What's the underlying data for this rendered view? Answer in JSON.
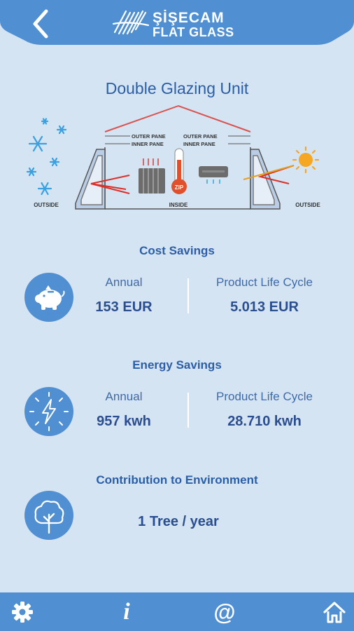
{
  "header": {
    "brand_line1": "ŞİŞECAM",
    "brand_line2": "FLAT GLASS"
  },
  "diagram": {
    "title": "Double Glazing Unit",
    "outer_pane_left": "OUTER PANE",
    "inner_pane_left": "INNER PANE",
    "outer_pane_right": "OUTER PANE",
    "inner_pane_right": "INNER PANE",
    "outside_left": "OUTSIDE",
    "inside": "INSIDE",
    "outside_right": "OUTSIDE",
    "thermometer_label": "ZIP"
  },
  "cost_savings": {
    "title": "Cost Savings",
    "annual_label": "Annual",
    "annual_value": "153 EUR",
    "lifecycle_label": "Product Life Cycle",
    "lifecycle_value": "5.013 EUR"
  },
  "energy_savings": {
    "title": "Energy Savings",
    "annual_label": "Annual",
    "annual_value": "957 kwh",
    "lifecycle_label": "Product Life Cycle",
    "lifecycle_value": "28.710 kwh"
  },
  "environment": {
    "title": "Contribution to Environment",
    "value": "1 Tree / year"
  },
  "colors": {
    "background": "#d5e4f3",
    "accent": "#4f8fd2",
    "text": "#2a4e8f"
  },
  "footer": {
    "icons": [
      "gear-icon",
      "info-icon",
      "at-icon",
      "home-icon"
    ],
    "info_glyph": "i",
    "at_glyph": "@"
  }
}
